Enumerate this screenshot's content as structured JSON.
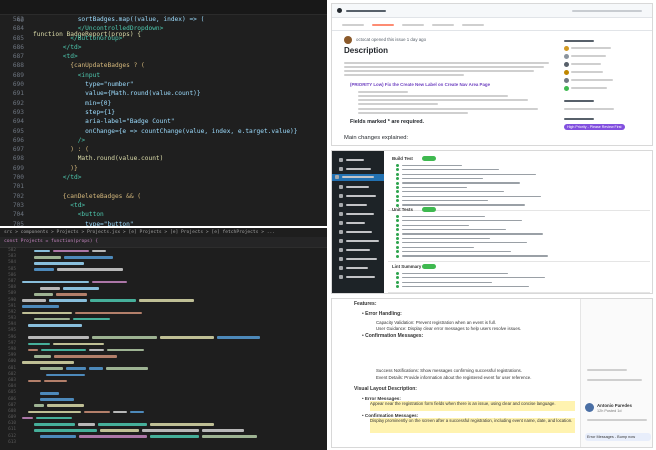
{
  "editor_top": {
    "lines": [
      {
        "n": "40",
        "text": "function BadgeReport(props) {"
      },
      {
        "n": "562",
        "text": "            sortBadges.map((value, index) => ("
      },
      {
        "n": "684",
        "text": "            </UncontrolledDropdown>"
      },
      {
        "n": "685",
        "text": "          </ButtonGroup>"
      },
      {
        "n": "686",
        "text": "        </td>"
      },
      {
        "n": "687",
        "text": "        <td>"
      },
      {
        "n": "688",
        "text": "          {canUpdateBadges ? ("
      },
      {
        "n": "689",
        "text": "            <input"
      },
      {
        "n": "690",
        "text": "              type=\"number\""
      },
      {
        "n": "691",
        "text": "              value={Math.round(value.count)}"
      },
      {
        "n": "692",
        "text": "              min={0}"
      },
      {
        "n": "693",
        "text": "              step={1}"
      },
      {
        "n": "694",
        "text": "              aria-label=\"Badge Count\""
      },
      {
        "n": "695",
        "text": "              onChange={e => countChange(value, index, e.target.value)}"
      },
      {
        "n": "696",
        "text": "            />"
      },
      {
        "n": "697",
        "text": "          ) : ("
      },
      {
        "n": "698",
        "text": "            Math.round(value.count)"
      },
      {
        "n": "699",
        "text": "          )}"
      },
      {
        "n": "700",
        "text": "        </td>"
      },
      {
        "n": "701",
        "text": ""
      },
      {
        "n": "702",
        "text": "        {canDeleteBadges && ("
      },
      {
        "n": "703",
        "text": "          <td>"
      },
      {
        "n": "704",
        "text": "            <button"
      },
      {
        "n": "705",
        "text": "              type=\"button\""
      },
      {
        "n": "706",
        "text": "              className=\"btn btn-outline-danger\""
      },
      {
        "n": "707",
        "text": "              onClick={() => handleDeleteBadge(sortBadges[index])}"
      },
      {
        "n": "708",
        "text": "              style={darkMode ? boxStyleDark : boxStyle}"
      }
    ]
  },
  "editor_bottom": {
    "breadcrumb": "src > components > Projects > Projects.jsx > [e] Projects > [e] Projects > [e] fetchProjects > ...",
    "header": "const Projects = function(props) {"
  },
  "github_issue": {
    "author_line": "octocat opened this issue 1 day ago",
    "heading": "Description",
    "priority": "(PRIORITY Low) Fix the Create New Label on Create Nav Area Page",
    "required_label": "Fields marked * are required.",
    "main_changes": "Main changes explained:",
    "label_badge": "High Priority - Please Review First"
  },
  "checks_panel": {
    "sections": [
      "Build Test",
      "Unit Tests",
      "Lint Summary"
    ]
  },
  "doc_panel": {
    "features": "Features:",
    "bullet_error": "Error Handling:",
    "error_sub_1": "Capacity Validation: Prevent registration when an event is full.",
    "error_sub_2": "User Guidance: Display clear error messages to help users resolve issues.",
    "bullet_confirm": "Confirmation Messages:",
    "success_notif": "Success Notifications: Show messages confirming successful registrations.",
    "event_details": "Event Details: Provide information about the registered event for user reference.",
    "visual_layout": "Visual Layout Description:",
    "vl_error": "Error Messages:",
    "vl_error_detail": "Appear near the registration form fields when there is an issue, using clear and concise language.",
    "vl_confirm": "Confirmation Messages:",
    "vl_confirm_detail": "Display prominently on the screen after a successful registration, including event name, date, and location.",
    "chat_name": "Antonio Paredes",
    "chat_time": "12h Posted 1d",
    "chat_msg": "Error Messages - Bump now"
  }
}
